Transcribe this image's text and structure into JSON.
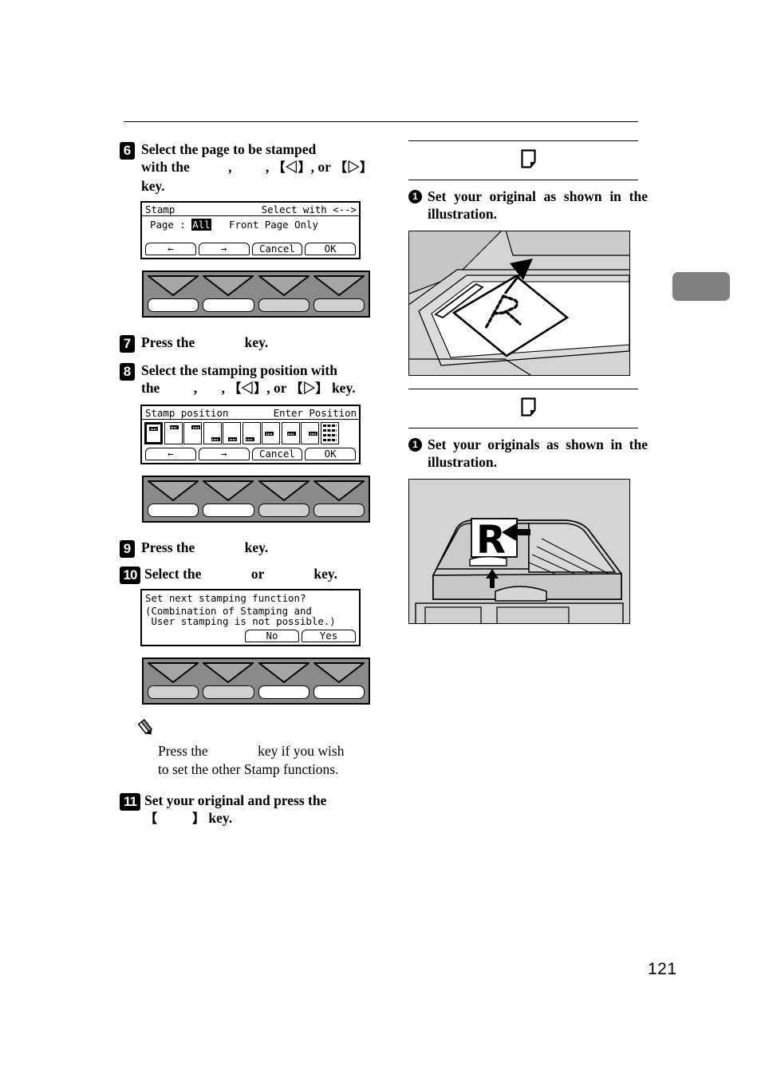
{
  "page": {
    "number": "121"
  },
  "left_column": {
    "steps": [
      {
        "num": "6",
        "text_a": "Select  the  page  to  be  stamped",
        "text_b": "with  the",
        "text_c": ",",
        "text_d": ",",
        "key_left": "【◁】",
        "text_or": ",  or",
        "key_right": "【▷】",
        "text_e": "key."
      },
      {
        "num": "7",
        "text_a": "Press the",
        "text_b": "key."
      },
      {
        "num": "8",
        "text_a": "Select the stamping position with",
        "text_b": "the",
        "text_c": ",",
        "text_d": ",",
        "key_left": "【◁】",
        "text_or": ", or",
        "key_right": "【▷】",
        "text_e": "key."
      },
      {
        "num": "9",
        "text_a": "Press the",
        "text_b": "key."
      },
      {
        "num": "10",
        "text_a": "Select the",
        "text_b": "or",
        "text_c": "key."
      },
      {
        "num": "11",
        "text_a": "Set  your  original  and  press  the",
        "key": "【",
        "key_close": "】",
        "text_b": "key."
      }
    ],
    "lcd_stamp": {
      "title": "Stamp",
      "hint": "Select with <-->",
      "field_label": "Page :",
      "field_value": "All",
      "field_option": "Front Page Only",
      "buttons": [
        "←",
        "→",
        "Cancel",
        "OK"
      ]
    },
    "lcd_position": {
      "title": "Stamp position",
      "hint": "Enter Position",
      "buttons": [
        "←",
        "→",
        "Cancel",
        "OK"
      ],
      "positions": [
        {
          "name": "top-left",
          "selected": true
        },
        {
          "name": "top-center",
          "selected": false
        },
        {
          "name": "top-right",
          "selected": false
        },
        {
          "name": "bottom-right",
          "selected": false
        },
        {
          "name": "bottom-center",
          "selected": false
        },
        {
          "name": "bottom-left",
          "selected": false
        },
        {
          "name": "middle-left",
          "selected": false
        },
        {
          "name": "middle-center",
          "selected": false
        },
        {
          "name": "middle-right",
          "selected": false
        },
        {
          "name": "all-positions",
          "selected": false
        }
      ]
    },
    "lcd_confirm": {
      "line1": "Set next stamping function?",
      "line2": "(Combination of Stamping and",
      "line3": " User stamping is not possible.)",
      "buttons": [
        "No",
        "Yes"
      ]
    },
    "key_panels": [
      {
        "name": "panel-after-stamp",
        "buttons": [
          "white",
          "white",
          "dim",
          "dim"
        ]
      },
      {
        "name": "panel-after-position",
        "buttons": [
          "white",
          "white",
          "dim",
          "dim"
        ]
      },
      {
        "name": "panel-after-confirm",
        "buttons": [
          "dim",
          "dim",
          "white",
          "white"
        ]
      }
    ],
    "note": {
      "icon": "pencil-icon",
      "text_a": "Press the",
      "text_b": "key if you wish",
      "text_c": "to set the other Stamp functions."
    }
  },
  "right_column": {
    "sections": [
      {
        "icon": "document-page-icon",
        "bullet": "1",
        "text": "Set your original as shown in the illustration.",
        "illustration": "exposure-glass-with-original"
      },
      {
        "icon": "document-page-icon",
        "bullet": "1",
        "text": "Set your originals as shown in the illustration.",
        "illustration": "document-feeder-with-originals"
      }
    ]
  },
  "colors": {
    "panel_body": "#8a8a8a",
    "panel_arrow": "#a6a6a6",
    "button_dim": "#cfcfcf",
    "illustration_bg": "#d4d4d4",
    "side_tab": "#808080"
  }
}
